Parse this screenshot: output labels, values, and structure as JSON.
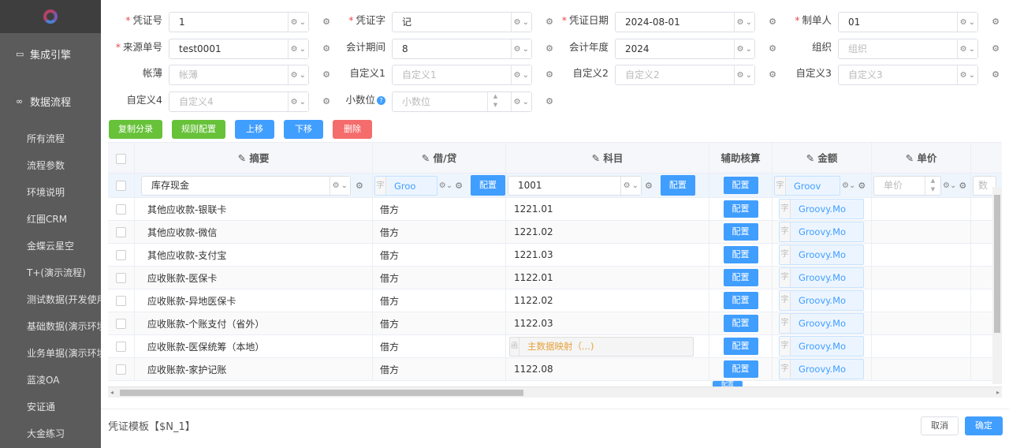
{
  "sidebar": {
    "main_items": [
      {
        "icon": "monitor-icon",
        "label": "集成引擎"
      },
      {
        "icon": "infinity-icon",
        "label": "数据流程"
      }
    ],
    "sub_items": [
      "所有流程",
      "流程参数",
      "环境说明",
      "红圈CRM",
      "金蝶云星空",
      "T+(演示流程)",
      "测试数据(开发使用",
      "基础数据(演示环境",
      "业务单据(演示环境",
      "蓝凌OA",
      "安证通",
      "大金练习"
    ]
  },
  "form": {
    "row1": [
      {
        "label": "凭证号",
        "value": "1",
        "required": true
      },
      {
        "label": "凭证字",
        "value": "记",
        "required": true
      },
      {
        "label": "凭证日期",
        "value": "2024-08-01",
        "required": true
      },
      {
        "label": "制单人",
        "value": "01",
        "required": true
      }
    ],
    "row2": [
      {
        "label": "来源单号",
        "value": "test0001",
        "required": true
      },
      {
        "label": "会计期间",
        "value": "8",
        "required": false
      },
      {
        "label": "会计年度",
        "value": "2024",
        "required": false
      },
      {
        "label": "组织",
        "placeholder": "组织",
        "required": false
      }
    ],
    "row3": [
      {
        "label": "帐薄",
        "placeholder": "帐薄"
      },
      {
        "label": "自定义1",
        "placeholder": "自定义1"
      },
      {
        "label": "自定义2",
        "placeholder": "自定义2"
      },
      {
        "label": "自定义3",
        "placeholder": "自定义3"
      }
    ],
    "row4": [
      {
        "label": "自定义4",
        "placeholder": "自定义4"
      },
      {
        "label": "小数位",
        "placeholder": "小数位",
        "help": "?"
      }
    ]
  },
  "toolbar": {
    "copy": "复制分录",
    "rule": "规则配置",
    "up": "上移",
    "down": "下移",
    "delete": "删除"
  },
  "grid": {
    "headers": {
      "summary": "摘要",
      "dc": "借/贷",
      "subject": "科目",
      "aux": "辅助核算",
      "amount": "金额",
      "price": "单价"
    },
    "edit_row": {
      "summary": "库存现金",
      "dc_tag": "字",
      "dc_value": "Groo",
      "config": "配置",
      "subject": "1001",
      "amount_tag": "字",
      "amount_value": "Groov",
      "price_placeholder": "单价",
      "next_placeholder": "数"
    },
    "rows": [
      {
        "summary": "其他应收款-银联卡",
        "dc": "借方",
        "subject": "1221.01",
        "aux": "配置",
        "amount_tag": "字",
        "amount": "Groovy.Mo"
      },
      {
        "summary": "其他应收款-微信",
        "dc": "借方",
        "subject": "1221.02",
        "aux": "配置",
        "amount_tag": "字",
        "amount": "Groovy.Mo"
      },
      {
        "summary": "其他应收款-支付宝",
        "dc": "借方",
        "subject": "1221.03",
        "aux": "配置",
        "amount_tag": "字",
        "amount": "Groovy.Mo"
      },
      {
        "summary": "应收账款-医保卡",
        "dc": "借方",
        "subject": "1122.01",
        "aux": "配置",
        "amount_tag": "字",
        "amount": "Groovy.Mo"
      },
      {
        "summary": "应收账款-异地医保卡",
        "dc": "借方",
        "subject": "1122.02",
        "aux": "配置",
        "amount_tag": "字",
        "amount": "Groovy.Mo"
      },
      {
        "summary": "应收账款-个账支付（省外）",
        "dc": "借方",
        "subject": "1122.03",
        "aux": "配置",
        "amount_tag": "字",
        "amount": "Groovy.Mo"
      },
      {
        "summary": "应收账款-医保统筹（本地）",
        "dc": "借方",
        "subject_tag": "函",
        "subject_mapping": "主数据映射（...)",
        "aux": "配置",
        "amount_tag": "字",
        "amount": "Groovy.Mo"
      },
      {
        "summary": "应收账款-家护记账",
        "dc": "借方",
        "subject": "1122.08",
        "aux": "配置",
        "amount_tag": "字",
        "amount": "Groovy.Mo"
      }
    ],
    "partial_row_button": "配置"
  },
  "footer": {
    "title": "凭证模板【$N_1】",
    "cancel": "取消",
    "ok": "确定"
  }
}
